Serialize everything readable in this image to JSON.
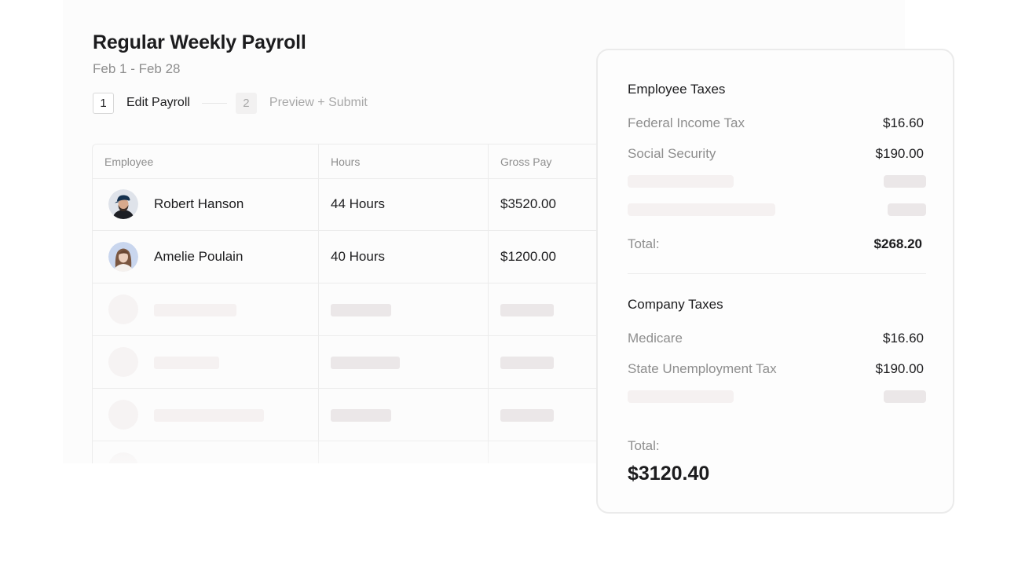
{
  "payroll": {
    "title": "Regular Weekly Payroll",
    "date_range": "Feb 1 - Feb 28",
    "steps": [
      {
        "number": "1",
        "label": "Edit Payroll",
        "active": true
      },
      {
        "number": "2",
        "label": "Preview + Submit",
        "active": false
      }
    ]
  },
  "table": {
    "headers": [
      "Employee",
      "Hours",
      "Gross Pay"
    ],
    "rows": [
      {
        "name": "Robert Hanson",
        "hours": "44 Hours",
        "gross_pay": "$3520.00"
      },
      {
        "name": "Amelie Poulain",
        "hours": "40 Hours",
        "gross_pay": "$1200.00"
      }
    ]
  },
  "taxes": {
    "employee": {
      "title": "Employee Taxes",
      "items": [
        {
          "label": "Federal Income Tax",
          "amount": "$16.60"
        },
        {
          "label": "Social Security",
          "amount": "$190.00"
        }
      ],
      "total_label": "Total:",
      "total_amount": "$268.20"
    },
    "company": {
      "title": "Company Taxes",
      "items": [
        {
          "label": "Medicare",
          "amount": "$16.60"
        },
        {
          "label": "State Unemployment Tax",
          "amount": "$190.00"
        }
      ]
    },
    "grand_total_label": "Total:",
    "grand_total_amount": "$3120.40"
  },
  "colors": {
    "text": "#1c1c1e",
    "muted": "#8e8e8e",
    "skeleton": "#ebe7e8",
    "border": "#ececec"
  }
}
